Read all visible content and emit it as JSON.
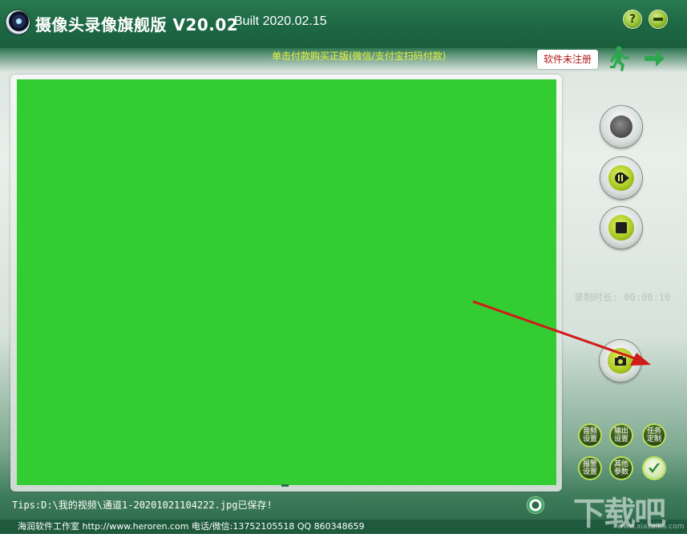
{
  "window": {
    "title": "摄像头录像旗舰版 V20.02",
    "build": "Built 2020.02.15",
    "help_label": "?"
  },
  "banner": {
    "promo": "单击付款购买正版(微信/支付宝扫码付款)",
    "unregistered": "软件未注册"
  },
  "controls": {
    "duration": "录制时长: 00:00:10",
    "settings": [
      {
        "label": "音频设置"
      },
      {
        "label": "输出设置"
      },
      {
        "label": "任务定制"
      },
      {
        "label": "报警设置"
      },
      {
        "label": "其他参数"
      }
    ]
  },
  "footer": {
    "tips": "Tips:D:\\我的视频\\通道1-20201021104222.jpg已保存!",
    "status": "海润软件工作室 http://www.heroren.com 电话/微信:13752105518 QQ 860348659"
  },
  "watermark": {
    "text": "下载吧",
    "sub": "www.xiazaiba.com"
  },
  "colors": {
    "video_background": "#33cc33",
    "title_bar": "#1e6a45",
    "annotation_arrow": "#d11a1a"
  }
}
